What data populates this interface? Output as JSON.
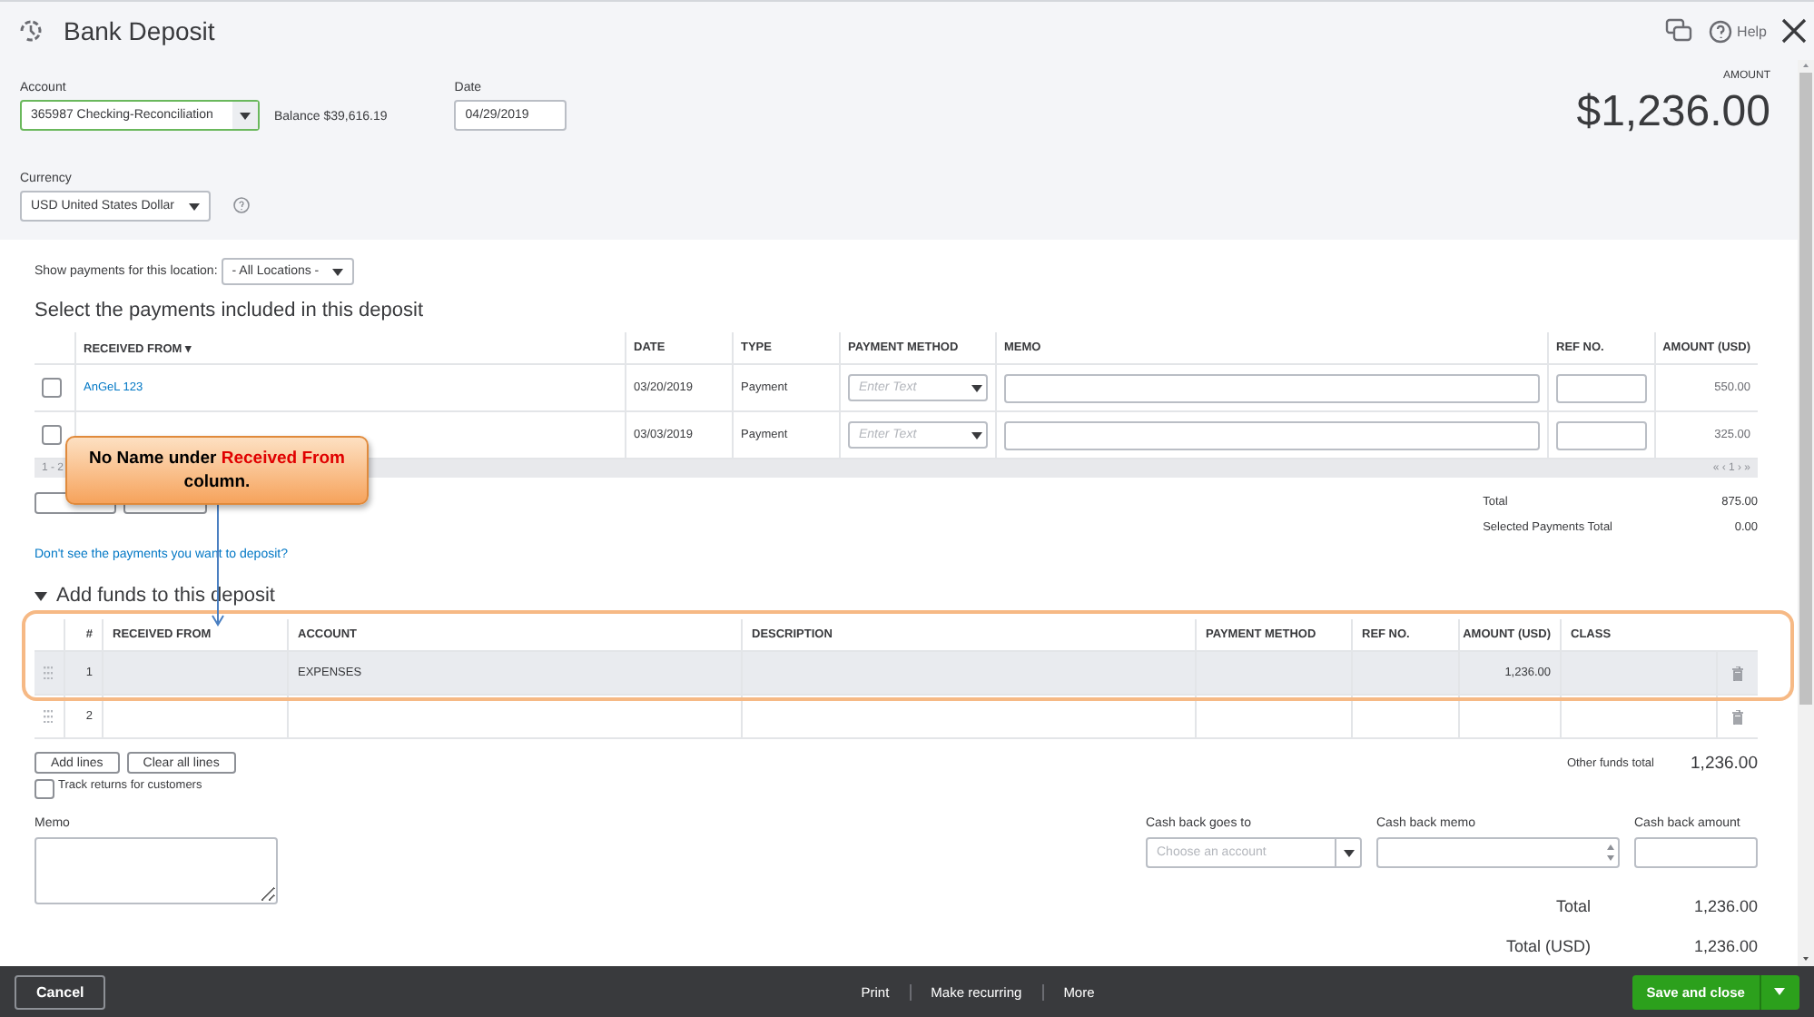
{
  "header": {
    "title": "Bank Deposit",
    "help": "Help",
    "amount_label": "AMOUNT",
    "amount": "$1,236.00"
  },
  "account": {
    "label": "Account",
    "value": "365987 Checking-Reconciliation",
    "balance": "Balance $39,616.19"
  },
  "date": {
    "label": "Date",
    "value": "04/29/2019"
  },
  "currency": {
    "label": "Currency",
    "value": "USD United States Dollar"
  },
  "location": {
    "label": "Show payments for this location:",
    "value": "- All Locations -"
  },
  "payments": {
    "heading": "Select the payments included in this deposit",
    "columns": [
      "RECEIVED FROM ▾",
      "DATE",
      "TYPE",
      "PAYMENT METHOD",
      "MEMO",
      "REF NO.",
      "AMOUNT (USD)"
    ],
    "rows": [
      {
        "checked": false,
        "received_from": "AnGeL 123",
        "date": "03/20/2019",
        "type": "Payment",
        "payment_method_placeholder": "Enter Text",
        "amount": "550.00"
      },
      {
        "checked": false,
        "date": "03/03/2019",
        "type": "Payment",
        "payment_method_placeholder": "Enter Text",
        "amount": "325.00"
      }
    ],
    "pager_range": "1 - 2",
    "pager_nav": "« ‹ 1 › »",
    "total_label": "Total",
    "total": "875.00",
    "selected_label": "Selected Payments Total",
    "selected_total": "0.00",
    "missing_link": "Don't see the payments you want to deposit?"
  },
  "funds": {
    "heading": "Add funds to this deposit",
    "expanded": true,
    "columns": [
      "#",
      "RECEIVED FROM",
      "ACCOUNT",
      "DESCRIPTION",
      "PAYMENT METHOD",
      "REF NO.",
      "AMOUNT (USD)",
      "CLASS"
    ],
    "rows": [
      {
        "number": "1",
        "account": "EXPENSES",
        "amount": "1,236.00",
        "highlighted": true
      },
      {
        "number": "2",
        "highlighted": false
      }
    ],
    "buttons": [
      "Add lines",
      "Clear all lines"
    ],
    "other_total_label": "Other funds total",
    "other_total": "1,236.00",
    "track_returns": {
      "label": "Track returns for customers",
      "checked": false
    }
  },
  "memo": {
    "label": "Memo"
  },
  "cash_back": {
    "goes_to_label": "Cash back goes to",
    "goes_to_placeholder": "Choose an account",
    "memo_label": "Cash back memo",
    "amount_label": "Cash back amount"
  },
  "totals": [
    {
      "label": "Total",
      "value": "1,236.00"
    },
    {
      "label": "Total (USD)",
      "value": "1,236.00"
    }
  ],
  "footer": {
    "cancel": "Cancel",
    "actions": [
      "Print",
      "Make recurring",
      "More"
    ],
    "save": "Save and close"
  },
  "callout": {
    "before": "No Name under",
    "highlight": "Received From",
    "after": "column."
  }
}
